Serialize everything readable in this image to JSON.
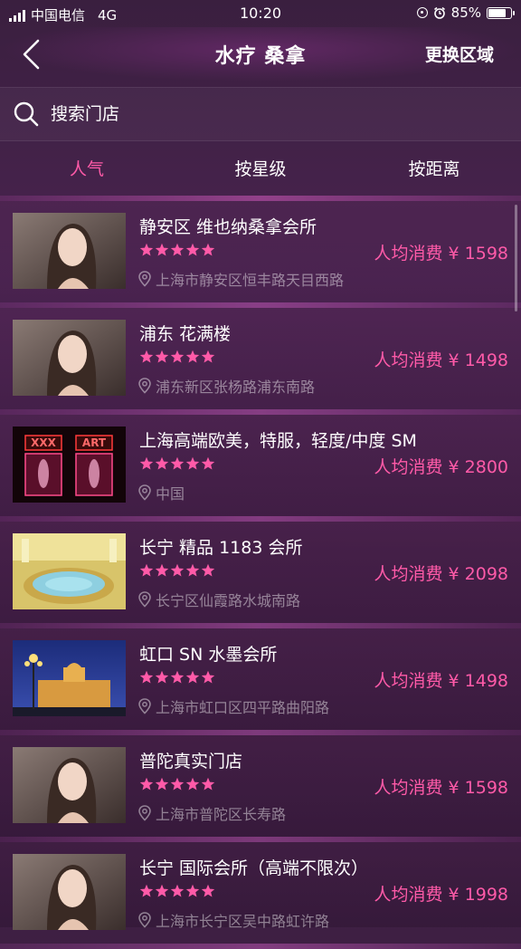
{
  "status_bar": {
    "carrier": "中国电信",
    "network": "4G",
    "time": "10:20",
    "battery_text": "85%",
    "battery_level": 0.85
  },
  "nav": {
    "title": "水疗 桑拿",
    "action": "更换区域"
  },
  "search": {
    "placeholder": "搜索门店"
  },
  "tabs": [
    {
      "label": "人气",
      "active": true
    },
    {
      "label": "按星级",
      "active": false
    },
    {
      "label": "按距离",
      "active": false
    }
  ],
  "accent_color": "#ff5aa8",
  "stores": [
    {
      "name": "静安区 维也纳桑拿会所",
      "rating": 5,
      "price": "人均消费 ¥ 1598",
      "address": "上海市静安区恒丰路天目西路",
      "thumb_icon": "portrait-photo"
    },
    {
      "name": "浦东 花满楼",
      "rating": 5,
      "price": "人均消费 ¥ 1498",
      "address": "浦东新区张杨路浦东南路",
      "thumb_icon": "portrait-photo"
    },
    {
      "name": "上海高端欧美，特服，轻度/中度 SM",
      "rating": 5,
      "price": "人均消费 ¥ 2800",
      "address": "中国",
      "thumb_icon": "neon-window-photo"
    },
    {
      "name": "长宁 精品 1183 会所",
      "rating": 5,
      "price": "人均消费 ¥ 2098",
      "address": "长宁区仙霞路水城南路",
      "thumb_icon": "pool-photo"
    },
    {
      "name": "虹口 SN 水墨会所",
      "rating": 5,
      "price": "人均消费 ¥ 1498",
      "address": "上海市虹口区四平路曲阳路",
      "thumb_icon": "night-building-photo"
    },
    {
      "name": "普陀真实门店",
      "rating": 5,
      "price": "人均消费 ¥ 1598",
      "address": "上海市普陀区长寿路",
      "thumb_icon": "portrait-photo"
    },
    {
      "name": "长宁 国际会所（高端不限次）",
      "rating": 5,
      "price": "人均消费 ¥ 1998",
      "address": "上海市长宁区吴中路虹许路",
      "thumb_icon": "portrait-photo"
    }
  ],
  "thumb_texts": {
    "sign_left": "XXX",
    "sign_right": "ART"
  }
}
